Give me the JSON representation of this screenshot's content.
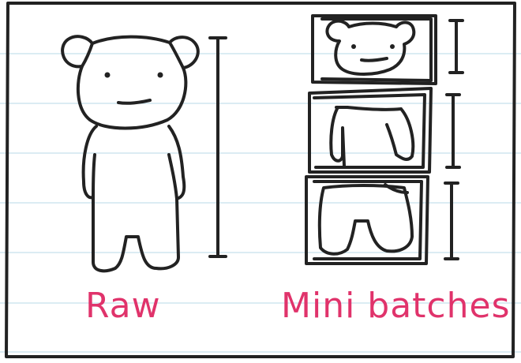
{
  "colors": {
    "ink": "#222222",
    "caption": "#e0336b",
    "rule_line": "#cfe6ef",
    "background": "#ffffff"
  },
  "captions": {
    "raw": "Raw",
    "mini_batches": "Mini batches"
  },
  "figures": {
    "raw": {
      "icon": "bear-full-icon",
      "batch_count": 1
    },
    "mini_batches": {
      "icon": "bear-sliced-icon",
      "batch_count": 3
    }
  }
}
